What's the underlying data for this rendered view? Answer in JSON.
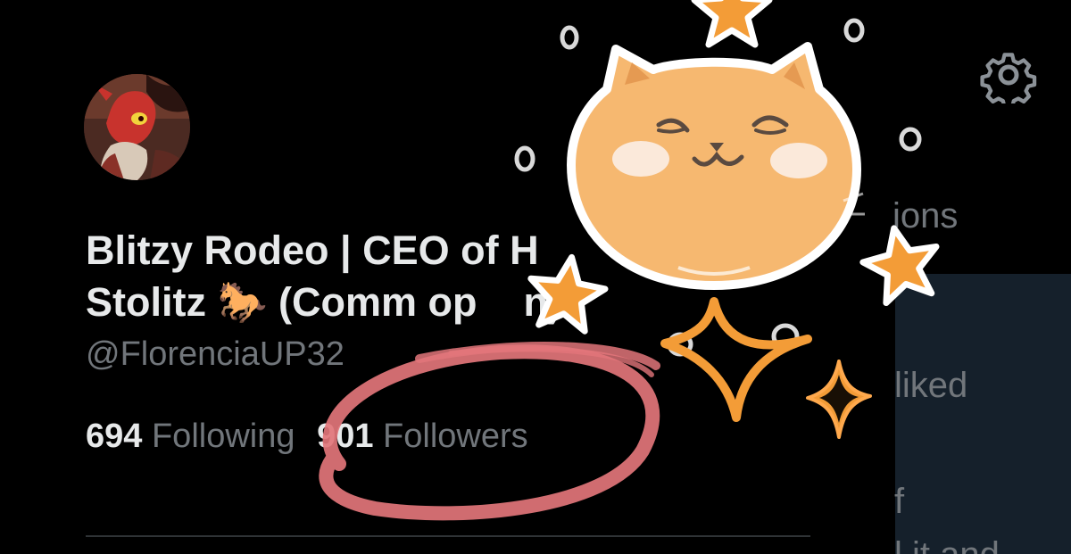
{
  "profile": {
    "name_line1": "Blitzy Rodeo | CEO of H",
    "name_line2": "Stolitz 🐎 (Comm op",
    "name_line2_end": "n)",
    "handle": "@FlorenciaUP32",
    "following_count": "694",
    "following_label": "Following",
    "followers_count": "901",
    "followers_label": "Followers"
  },
  "side": {
    "text_1": "ions",
    "text_2": "liked",
    "text_3": "f",
    "text_4": "l it and"
  },
  "icons": {
    "settings": "gear-icon",
    "avatar": "avatar-image",
    "sticker": "cat-face-sticker",
    "circle": "red-circle-marker"
  },
  "colors": {
    "background": "#000000",
    "text_primary": "#e7e9ea",
    "text_secondary": "#71767b",
    "circle_marker": "#e2757a",
    "cat_orange": "#f6b870",
    "star_orange": "#f39c37"
  }
}
